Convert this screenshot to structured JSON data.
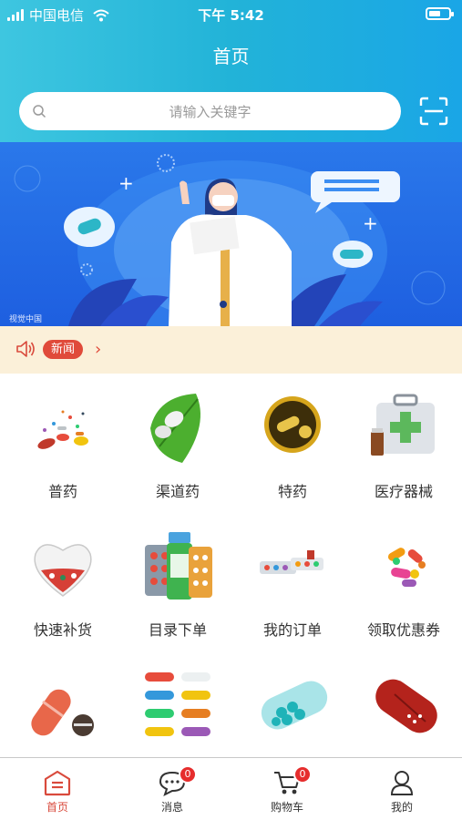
{
  "status_bar": {
    "carrier": "中国电信",
    "time": "下午 5:42"
  },
  "header": {
    "title": "首页"
  },
  "search": {
    "placeholder": "请输入关键字"
  },
  "banner": {
    "caption": "视觉中国"
  },
  "news": {
    "tag": "新闻"
  },
  "grid": [
    {
      "label": "普药",
      "icon": "pills-icon"
    },
    {
      "label": "渠道药",
      "icon": "green-leaf-pill-icon"
    },
    {
      "label": "特药",
      "icon": "gold-coin-pill-icon"
    },
    {
      "label": "医疗器械",
      "icon": "medical-kit-icon"
    },
    {
      "label": "快速补货",
      "icon": "heart-pills-icon"
    },
    {
      "label": "目录下单",
      "icon": "pill-bottle-blister-icon"
    },
    {
      "label": "我的订单",
      "icon": "pill-blister-strip-icon"
    },
    {
      "label": "领取优惠券",
      "icon": "colorful-capsules-icon"
    },
    {
      "label": "",
      "icon": "capsule-tablet-icon"
    },
    {
      "label": "",
      "icon": "capsule-rows-icon"
    },
    {
      "label": "",
      "icon": "teal-capsule-icon"
    },
    {
      "label": "",
      "icon": "red-capsule-icon"
    }
  ],
  "tabbar": {
    "tabs": [
      {
        "label": "首页",
        "active": true
      },
      {
        "label": "消息",
        "badge": "0"
      },
      {
        "label": "购物车",
        "badge": "0"
      },
      {
        "label": "我的"
      }
    ]
  },
  "colors": {
    "header_start": "#3ec6e0",
    "header_end": "#1aa6e6",
    "accent_red": "#d94a3c",
    "news_bg": "#fbf0d9"
  }
}
